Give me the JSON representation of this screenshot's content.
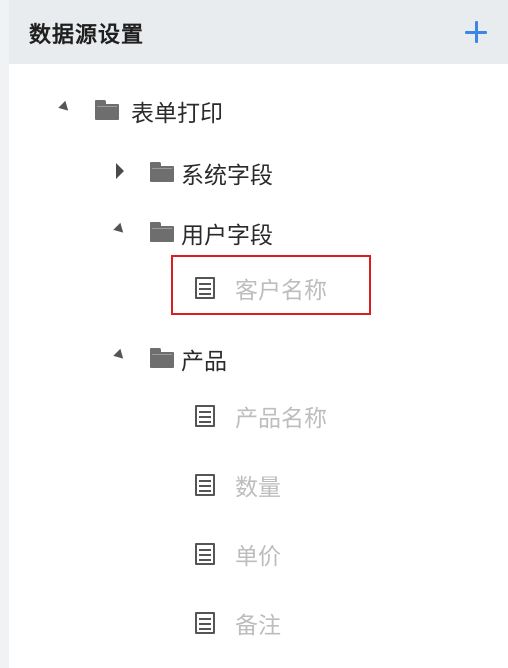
{
  "header": {
    "title": "数据源设置",
    "add_icon": "plus-icon",
    "accent_color": "#3c86e6"
  },
  "tree": {
    "root": {
      "label": "表单打印",
      "expanded": true
    },
    "groups": [
      {
        "label": "系统字段",
        "expanded": false,
        "fields": []
      },
      {
        "label": "用户字段",
        "expanded": true,
        "fields": [
          {
            "label": "客户名称",
            "selected": true
          }
        ]
      },
      {
        "label": "产品",
        "expanded": true,
        "fields": [
          {
            "label": "产品名称"
          },
          {
            "label": "数量"
          },
          {
            "label": "单价"
          },
          {
            "label": "备注"
          }
        ]
      }
    ]
  },
  "selection_color": "#d81e1e"
}
